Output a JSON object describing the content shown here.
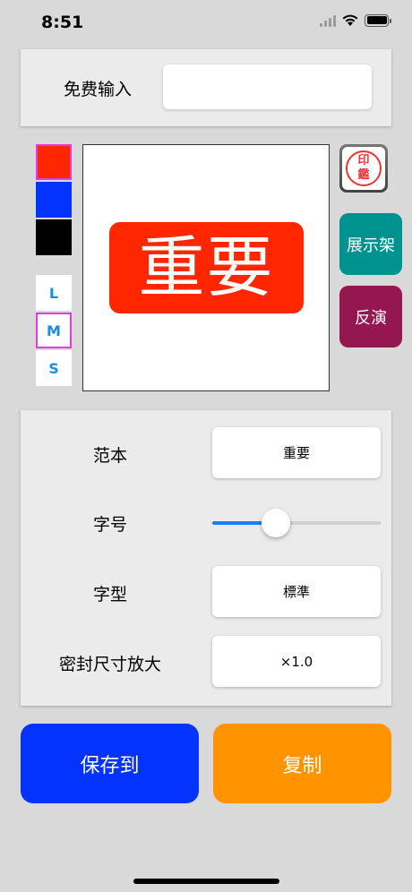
{
  "status": {
    "time": "8:51"
  },
  "free_input": {
    "label": "免费输入",
    "value": ""
  },
  "colors": {
    "red": "#ff2600",
    "blue": "#0433ff",
    "black": "#000000",
    "selected_outline": "#e23be6"
  },
  "sizes": [
    "L",
    "M",
    "S"
  ],
  "selected_size": "M",
  "preview": {
    "stamp_text": "重要"
  },
  "side_buttons": {
    "seal_icon_text": [
      "印",
      "鑑"
    ],
    "display": "展示架",
    "reverse": "反演"
  },
  "settings": {
    "template": {
      "label": "范本",
      "value": "重要"
    },
    "font_size": {
      "label": "字号",
      "level": 0.38
    },
    "font_style": {
      "label": "字型",
      "value": "標準"
    },
    "seal_scale": {
      "label": "密封尺寸放大",
      "value": "×1.0"
    }
  },
  "actions": {
    "save": "保存到",
    "copy": "复制"
  }
}
